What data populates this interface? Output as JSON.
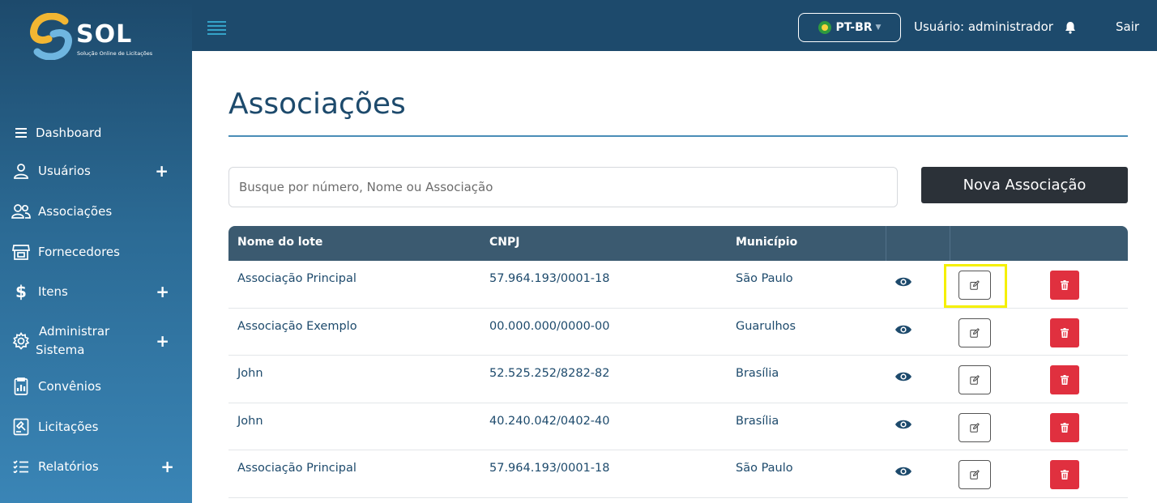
{
  "brand": {
    "name": "SOL",
    "tagline": "Solução Online de Licitações"
  },
  "sidebar": {
    "items": [
      {
        "label": "Dashboard",
        "icon": "list-icon",
        "expand": ""
      },
      {
        "label": "Usuários",
        "icon": "user-icon",
        "expand": "+"
      },
      {
        "label": "Associações",
        "icon": "users-icon",
        "expand": ""
      },
      {
        "label": "Fornecedores",
        "icon": "store-icon",
        "expand": ""
      },
      {
        "label": "Itens",
        "icon": "dollar-icon",
        "expand": "+"
      },
      {
        "label_line1": "Administrar",
        "label_line2": "Sistema",
        "icon": "gear-icon",
        "expand": "+"
      },
      {
        "label": "Convênios",
        "icon": "chart-doc-icon",
        "expand": ""
      },
      {
        "label": "Licitações",
        "icon": "auction-icon",
        "expand": ""
      },
      {
        "label": "Relatórios",
        "icon": "checklist-icon",
        "expand": "+"
      }
    ]
  },
  "topbar": {
    "language": "PT-BR",
    "user": "Usuário: administrador",
    "exit": "Sair"
  },
  "main": {
    "title": "Associações",
    "search_placeholder": "Busque por número, Nome ou Associação",
    "new_button": "Nova Associação"
  },
  "table": {
    "headers": [
      "Nome do lote",
      "CNPJ",
      "Município"
    ],
    "rows": [
      {
        "name": "Associação Principal",
        "cnpj": "57.964.193/0001-18",
        "city": "São Paulo"
      },
      {
        "name": "Associação Exemplo",
        "cnpj": "00.000.000/0000-00",
        "city": "Guarulhos"
      },
      {
        "name": "John",
        "cnpj": "52.525.252/8282-82",
        "city": "Brasília"
      },
      {
        "name": "John",
        "cnpj": "40.240.042/0402-40",
        "city": "Brasília"
      },
      {
        "name": "Associação Principal",
        "cnpj": "57.964.193/0001-18",
        "city": "São Paulo"
      }
    ]
  },
  "colors": {
    "sidebar": "#1d4a6c",
    "header": "#3b5a70",
    "accent": "#e0303f",
    "highlight": "#f5f000"
  }
}
